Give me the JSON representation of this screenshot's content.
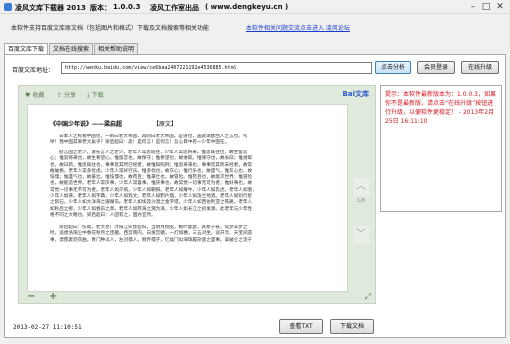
{
  "window": {
    "app_name": "凌风文库下载器 2013",
    "version_label": "版本：",
    "version": "1.0.0.3",
    "studio": "凌风工作室出品",
    "website": "( www.dengkeyu.cn )",
    "controls": [
      "–",
      "□",
      "✕"
    ]
  },
  "header": {
    "intro": "本软件支持百度文库原文档（包括图片和格式）下载及文档搜索等相关功能",
    "link": "本软件相关问题交流点击进入 凌风论坛"
  },
  "tabs": [
    "百度文库下载",
    "文档在线搜索",
    "相关帮助说明"
  ],
  "url_bar": {
    "label": "百度文库地址：",
    "value": "http://wenku.baidu.com/view/ce6baa2407221192e4536885.html",
    "analyze_button": "点击分析",
    "member_button": "会员登录",
    "upgrade_button": "在线升级"
  },
  "viewer": {
    "toolbar": {
      "favorite": "收藏",
      "share": "分享",
      "download": "下载",
      "logo": "Bai文库"
    },
    "doc_title": "《中国少年说》——梁启超",
    "doc_tag": "【原文】",
    "paragraphs": [
      [
        "日本人之称我中国也，一则曰老大帝国，再则曰老大帝国。是语也，盖袭译欧西人之言也。呜",
        "呼！我中国其果老大矣乎？梁启超曰：恶！是何言！是何言！吾心目中有一少年中国在。"
      ],
      [
        "欲言国之老少，请先言人之老少。老年人常思既往，少年人常思将来。惟思既往也，故生留恋",
        "心；惟思将来也，故生希望心。惟留恋也，故保守；惟希望也，故进取。惟保守也，故永旧；惟进取",
        "也，故日新。惟思既往也，事事皆其所已经者，故惟知照例；惟思将来也，事事皆其所未经者，故常",
        "敢破格。老年人常多忧虑，少年人常好行乐。惟多忧也，故灰心；惟行乐也，故盛气。惟灰心也，故",
        "怯懦；惟盛气也，故豪壮。惟怯懦也，故苟且；惟豪壮也，故冒险。惟苟且也，故能灭世界；惟冒险",
        "也，故能造世界。老年人常厌事，少年人常喜事。惟厌事也，故常觉一切事无可为者；惟好事也，故",
        "常觉一切事无不可为者。老年人如夕照，少年人如朝阳。老年人如瘠牛，少年人如乳虎。老年人如僧，",
        "少年人如侠。老年人如字典，少年人如戏文。老年人如鸦片烟，少年人如泼兰地酒。老年人如别行星",
        "之陨石，少年人如大洋海之珊瑚岛。老年人如埃及沙漠之金字塔，少年人如西伯利亚之铁路。老年人",
        "如秋后之柳，少年人如春前之草。老年人如死海之潴为泽，少年人如长江之初发源。此老年与少年性",
        "格不同之大略也。梁启超曰：人固有之，国亦宜然。"
      ],
      [
        "梁启超曰：伤哉，老大也！浔阳江头琵琶妇，当明月绕船，枫叶瑟瑟，衾寒于铁，似梦非梦之",
        "时，追想洛阳尘中春花秋月之佳趣。西宫南内，白发宫娥，一灯如穗，三五对坐，谈开元、天宝间遗",
        "事，谱霓裳羽衣曲。青门种瓜人，左对孺人，顾弄孺子，忆侯门似海珠履杂遝之盛事。拿破仑之流于"
      ]
    ],
    "page_num": "1/8"
  },
  "hint": "提示：本软件最新版本为：1.0.0.3，如果你不是最新版，请点击“在线升级”按钮进行升级，以便软件更稳定！ - 2013年2月25日 16:11:10",
  "status": {
    "datetime": "2013-02-27 11:10:51",
    "view_txt_button": "查看TXT",
    "download_doc_button": "下载文档"
  },
  "colors": {
    "hint_text": "#d0161f",
    "link": "#1a3fcf",
    "viewer_bg": "#dfe9dc"
  }
}
